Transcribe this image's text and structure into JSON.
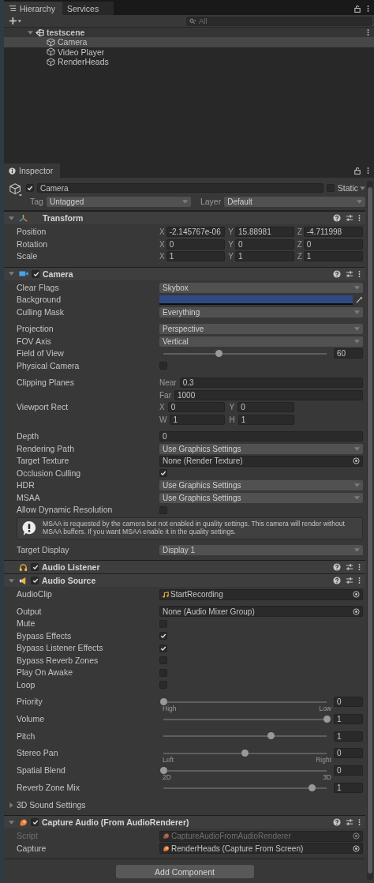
{
  "hierarchy": {
    "tabs": [
      {
        "label": "Hierarchy",
        "selected": true
      },
      {
        "label": "Services",
        "selected": false
      }
    ],
    "search": {
      "placeholder": "All"
    },
    "tree": [
      {
        "label": "testscene",
        "kind": "scene",
        "expanded": true,
        "selected": false,
        "children": [
          {
            "label": "Camera",
            "kind": "object",
            "selected": true
          },
          {
            "label": "Video Player",
            "kind": "object",
            "selected": false
          },
          {
            "label": "RenderHeads",
            "kind": "object",
            "selected": false
          }
        ]
      }
    ]
  },
  "inspector": {
    "tab": {
      "label": "Inspector"
    },
    "object": {
      "active": true,
      "name": "Camera",
      "static": false,
      "static_label": "Static",
      "tag_label": "Tag",
      "tag": "Untagged",
      "layer_label": "Layer",
      "layer": "Default"
    },
    "components": [
      {
        "title": "Transform",
        "kind": "transform",
        "expanded": true,
        "groups": [
          [
            {
              "kind": "vector3",
              "label": "Position",
              "fields": [
                {
                  "axis": "X",
                  "value": "-2.145767e-06"
                },
                {
                  "axis": "Y",
                  "value": "15.88981"
                },
                {
                  "axis": "Z",
                  "value": "-4.711998"
                }
              ]
            },
            {
              "kind": "vector3",
              "label": "Rotation",
              "fields": [
                {
                  "axis": "X",
                  "value": "0"
                },
                {
                  "axis": "Y",
                  "value": "0"
                },
                {
                  "axis": "Z",
                  "value": "0"
                }
              ]
            },
            {
              "kind": "vector3",
              "label": "Scale",
              "fields": [
                {
                  "axis": "X",
                  "value": "1"
                },
                {
                  "axis": "Y",
                  "value": "1"
                },
                {
                  "axis": "Z",
                  "value": "1"
                }
              ]
            }
          ]
        ]
      },
      {
        "title": "Camera",
        "kind": "camera",
        "expanded": true,
        "enabled": true,
        "groups": [
          [
            {
              "kind": "dropdown",
              "label": "Clear Flags",
              "value": "Skybox"
            },
            {
              "kind": "color",
              "label": "Background",
              "color": "#2f4a80"
            },
            {
              "kind": "dropdown",
              "label": "Culling Mask",
              "value": "Everything"
            }
          ],
          [
            {
              "kind": "dropdown",
              "label": "Projection",
              "value": "Perspective"
            },
            {
              "kind": "dropdown",
              "label": "FOV Axis",
              "value": "Vertical"
            },
            {
              "kind": "slider",
              "label": "Field of View",
              "level": 0.34,
              "value": "60"
            },
            {
              "kind": "checkbox",
              "label": "Physical Camera",
              "checked": false
            }
          ],
          [
            {
              "kind": "stack",
              "label": "Clipping Planes",
              "lines": [
                [
                  {
                    "axis": "Near",
                    "value": "0.3"
                  }
                ],
                [
                  {
                    "axis": "Far",
                    "value": "1000"
                  }
                ]
              ]
            },
            {
              "kind": "stack",
              "label": "Viewport Rect",
              "lines": [
                [
                  {
                    "axis": "X",
                    "value": "0"
                  },
                  {
                    "axis": "Y",
                    "value": "0"
                  }
                ],
                [
                  {
                    "axis": "W",
                    "value": "1"
                  },
                  {
                    "axis": "H",
                    "value": "1"
                  }
                ]
              ]
            }
          ],
          [
            {
              "kind": "field",
              "label": "Depth",
              "value": "0"
            },
            {
              "kind": "dropdown",
              "label": "Rendering Path",
              "value": "Use Graphics Settings"
            },
            {
              "kind": "object",
              "label": "Target Texture",
              "value": "None (Render Texture)"
            },
            {
              "kind": "checkbox",
              "label": "Occlusion Culling",
              "checked": true
            },
            {
              "kind": "dropdown",
              "label": "HDR",
              "value": "Use Graphics Settings"
            },
            {
              "kind": "dropdown",
              "label": "MSAA",
              "value": "Use Graphics Settings"
            },
            {
              "kind": "checkbox",
              "label": "Allow Dynamic Resolution",
              "checked": false
            },
            {
              "kind": "help",
              "text": "MSAA is requested by the camera but not enabled in quality settings. This camera will render without MSAA buffers. If you want MSAA enable it in the quality settings."
            }
          ],
          [
            {
              "kind": "dropdown",
              "label": "Target Display",
              "value": "Display 1"
            }
          ]
        ]
      },
      {
        "title": "Audio Listener",
        "kind": "listener",
        "enabled": true
      },
      {
        "title": "Audio Source",
        "kind": "source",
        "expanded": true,
        "enabled": true,
        "groups": [
          [
            {
              "kind": "clip",
              "label": "AudioClip",
              "value": "StartRecording"
            }
          ],
          [
            {
              "kind": "object",
              "label": "Output",
              "value": "None (Audio Mixer Group)"
            },
            {
              "kind": "checkbox",
              "label": "Mute",
              "checked": false
            },
            {
              "kind": "checkbox",
              "label": "Bypass Effects",
              "checked": true
            },
            {
              "kind": "checkbox",
              "label": "Bypass Listener Effects",
              "checked": true
            },
            {
              "kind": "checkbox",
              "label": "Bypass Reverb Zones",
              "checked": false
            },
            {
              "kind": "checkbox",
              "label": "Play On Awake",
              "checked": false
            },
            {
              "kind": "checkbox",
              "label": "Loop",
              "checked": false
            }
          ],
          [
            {
              "kind": "slider",
              "label": "Priority",
              "level": 0,
              "value": "0",
              "ends": [
                "High",
                "Low"
              ]
            },
            {
              "kind": "slider",
              "label": "Volume",
              "level": 1,
              "value": "1"
            }
          ],
          [
            {
              "kind": "slider",
              "label": "Pitch",
              "level": 0.66,
              "value": "1"
            }
          ],
          [
            {
              "kind": "slider",
              "label": "Stereo Pan",
              "level": 0.5,
              "value": "0",
              "ends": [
                "Left",
                "Right"
              ]
            },
            {
              "kind": "slider",
              "label": "Spatial Blend",
              "level": 0,
              "value": "0",
              "ends": [
                "2D",
                "3D"
              ]
            },
            {
              "kind": "slider",
              "label": "Reverb Zone Mix",
              "level": 0.91,
              "value": "1"
            }
          ],
          [
            {
              "kind": "foldout",
              "label": "3D Sound Settings",
              "expanded": false
            }
          ]
        ]
      },
      {
        "title": "Capture Audio (From AudioRenderer)",
        "kind": "script",
        "expanded": true,
        "enabled": true,
        "groups": [
          [
            {
              "kind": "script",
              "label": "Script",
              "value": "CaptureAudioFromAudioRenderer",
              "disabled": true
            },
            {
              "kind": "script",
              "label": "Capture",
              "value": "RenderHeads (Capture From Screen)",
              "disabled": false
            }
          ]
        ]
      }
    ],
    "add_button": "Add Component"
  }
}
